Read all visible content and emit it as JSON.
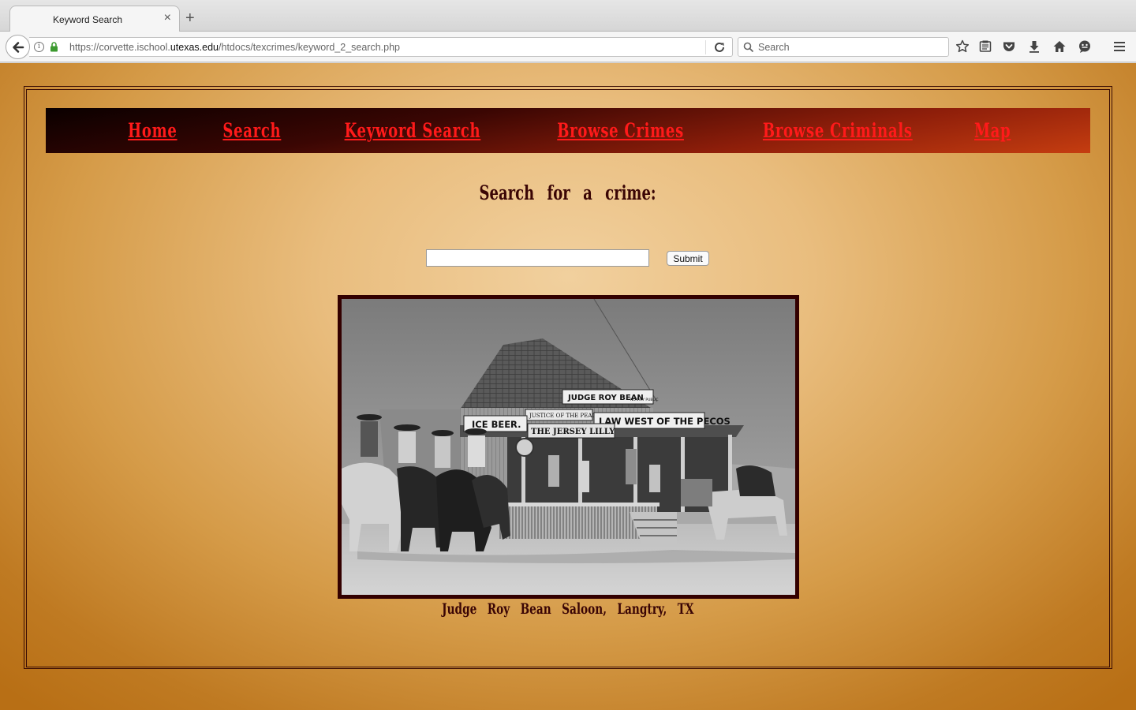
{
  "browser": {
    "tab_title": "Keyword Search",
    "tab_close": "×",
    "new_tab": "+",
    "url_prefix": "https://corvette.ischool.",
    "url_domain": "utexas.edu",
    "url_path": "/htdocs/texcrimes/keyword_2_search.php",
    "search_placeholder": "Search",
    "toolbar_icons": [
      "star-icon",
      "reading-list-icon",
      "pocket-icon",
      "download-icon",
      "home-icon",
      "feedback-icon",
      "menu-icon"
    ]
  },
  "nav": {
    "items": [
      "Home",
      "Search",
      "Keyword Search",
      "Browse Crimes",
      "Browse Criminals",
      "Map"
    ]
  },
  "search": {
    "heading": "Search for a crime:",
    "input_value": "",
    "submit_label": "Submit"
  },
  "photo": {
    "signs": {
      "judge": "JUDGE ROY BEAN",
      "notary": "NOTARY PUBLIC",
      "justice": "JUSTICE OF THE PEACE",
      "law": "LAW WEST OF THE PECOS",
      "ice_beer": "ICE BEER.",
      "jersey": "THE JERSEY LILLY"
    },
    "caption": "Judge Roy Bean Saloon, Langtry, TX"
  },
  "colors": {
    "nav_link": "#ff1a1a",
    "heading": "#3a0505",
    "photo_border": "#330000"
  }
}
